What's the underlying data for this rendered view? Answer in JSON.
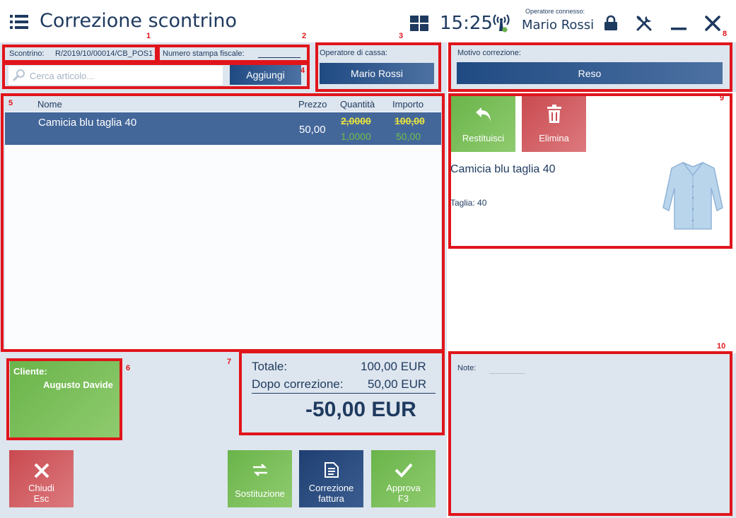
{
  "header": {
    "title": "Correzione scontrino",
    "time": "15:25",
    "operator_label": "Operatore connesso:",
    "operator_name": "Mario Rossi"
  },
  "annotations": [
    "1",
    "2",
    "3",
    "4",
    "5",
    "6",
    "7",
    "8",
    "9",
    "10"
  ],
  "receipt": {
    "label": "Scontrino:",
    "value": "R/2019/10/00014/CB_POS1",
    "fiscal_label": "Numero stampa fiscale:",
    "fiscal_value": ""
  },
  "search": {
    "placeholder": "Cerca articolo...",
    "add_label": "Aggiungi"
  },
  "cashier": {
    "label": "Operatore di cassa:",
    "value": "Mario Rossi"
  },
  "reason": {
    "label": "Motivo correzione:",
    "value": "Reso"
  },
  "table": {
    "columns": [
      "Nome",
      "Prezzo",
      "Quantità",
      "Importo"
    ],
    "rows": [
      {
        "name": "Camicia blu taglia 40",
        "price": "50,00",
        "qty_old": "2,0000",
        "qty_new": "1,0000",
        "amount_old": "100,00",
        "amount_new": "50,00"
      }
    ]
  },
  "item_actions": {
    "return_label": "Restituisci",
    "delete_label": "Elimina"
  },
  "item_detail": {
    "name": "Camicia blu taglia 40",
    "attribute": "Taglia: 40"
  },
  "customer": {
    "label": "Cliente:",
    "name": "Augusto Davide"
  },
  "totals": {
    "total_label": "Totale:",
    "total_value": "100,00 EUR",
    "after_label": "Dopo correzione:",
    "after_value": "50,00 EUR",
    "difference": "-50,00 EUR"
  },
  "notes": {
    "label": "Note:"
  },
  "bottom_buttons": {
    "close_line1": "Chiudi",
    "close_line2": "Esc",
    "substitution": "Sostituzione",
    "invoice_line1": "Correzione",
    "invoice_line2": "fattura",
    "approve_line1": "Approva",
    "approve_line2": "F3"
  },
  "colors": {
    "navy": "#1e3a5f",
    "panel": "#dde5ee",
    "selected_row": "#44679a",
    "green": "#6ab44a",
    "red": "#c94a4f",
    "annotation": "#e0151b"
  }
}
